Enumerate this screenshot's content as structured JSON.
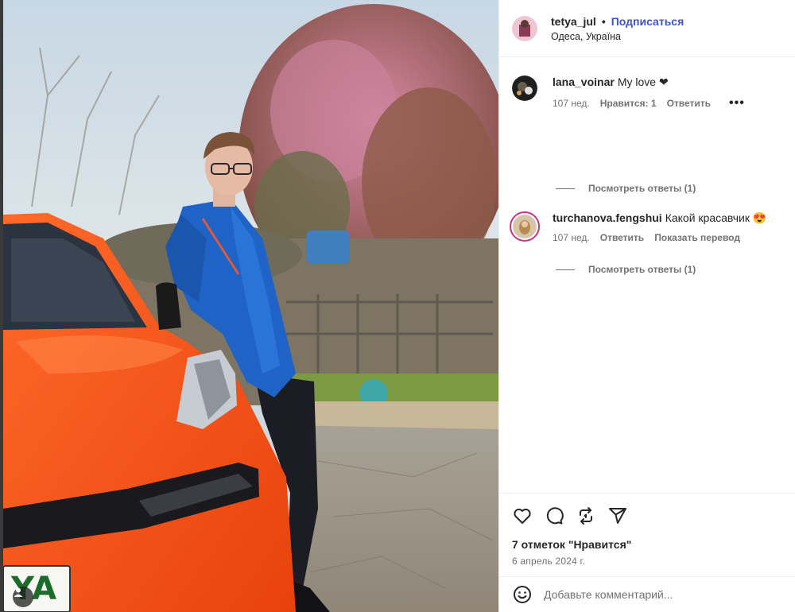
{
  "post": {
    "author": "tetya_jul",
    "separator": "•",
    "follow_label": "Подписаться",
    "location": "Одеса, Україна",
    "plate_text": "YA"
  },
  "comments": [
    {
      "username": "lana_voinar",
      "text": "My love",
      "emoji": "❤",
      "age": "107 нед.",
      "likes": "Нравится: 1",
      "reply_label": "Ответить",
      "more": "•••",
      "view_replies": "Посмотреть ответы (1)"
    },
    {
      "username": "turchanova.fengshui",
      "text": "Какой красавчик",
      "emoji": "😍",
      "age": "107 нед.",
      "reply_label": "Ответить",
      "translate_label": "Показать перевод",
      "view_replies": "Посмотреть ответы (1)"
    }
  ],
  "actions": {
    "likes_text": "7 отметок \"Нравится\"",
    "date": "6 апрель 2024 г.",
    "icons": [
      "heart-icon",
      "comment-icon",
      "repost-icon",
      "share-icon"
    ]
  },
  "composer": {
    "placeholder": "Добавьте комментарий..."
  },
  "colors": {
    "accent": "#4054c8",
    "car": "#ff5a1a",
    "jacket": "#1f63c6"
  }
}
